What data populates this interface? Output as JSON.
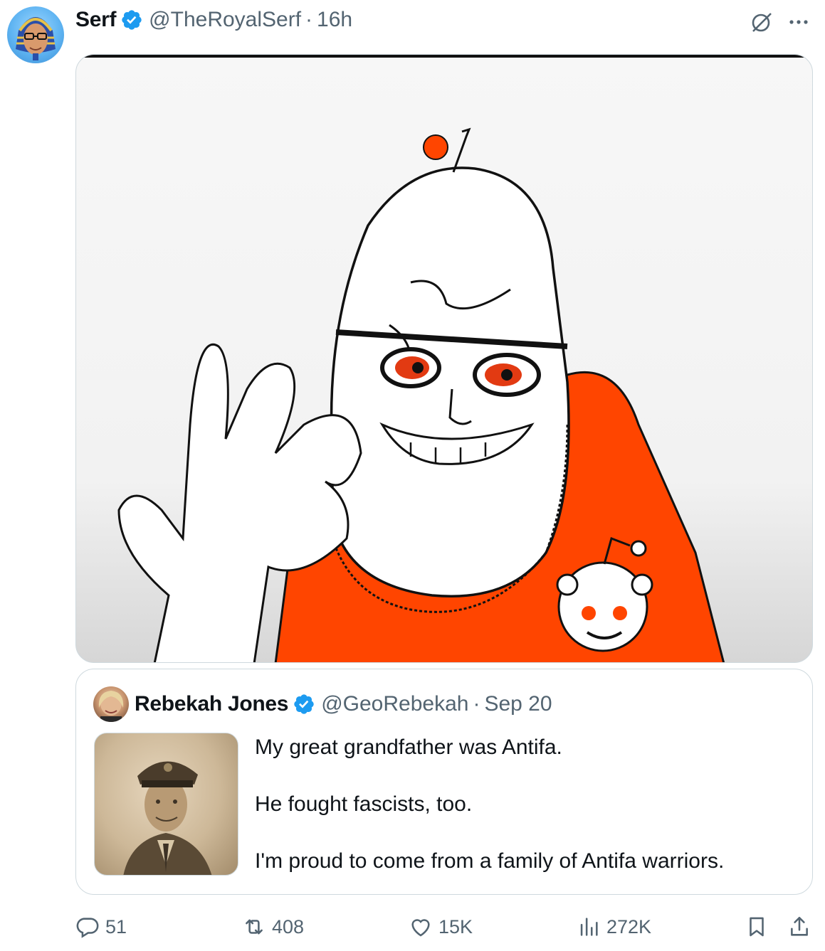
{
  "tweet": {
    "author_name": "Serf",
    "author_handle": "@TheRoyalSerf",
    "separator": "·",
    "time": "16h",
    "verified": true,
    "verified_color": "#1d9bf0",
    "icons": [
      "grok-icon",
      "more-icon"
    ]
  },
  "media": {
    "description_icon": "image",
    "accent_color": "#ff4500"
  },
  "quote": {
    "author_name": "Rebekah Jones",
    "author_handle": "@GeoRebekah",
    "separator": "·",
    "time": "Sep 20",
    "verified": true,
    "lines": [
      "My great grandfather was Antifa.",
      "He fought fascists, too.",
      "I'm proud to come from a family of Antifa warriors."
    ]
  },
  "actions": {
    "reply_count": "51",
    "retweet_count": "408",
    "like_count": "15K",
    "views_count": "272K",
    "icons": [
      "reply-icon",
      "retweet-icon",
      "like-icon",
      "views-icon",
      "bookmark-icon",
      "share-icon"
    ]
  }
}
